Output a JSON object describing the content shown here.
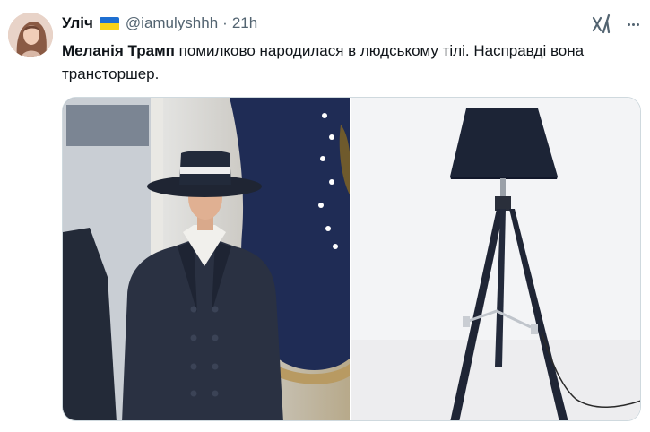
{
  "author": {
    "name": "Уліч",
    "flag": "ukraine-flag",
    "handle": "@iamulyshhh",
    "separator": "·",
    "time": "21h"
  },
  "tweet": {
    "bold_text": "Меланія Трамп",
    "text": " помилково народилася в людському тілі. Насправді вона трансторшер."
  },
  "media": {
    "images": [
      {
        "icon": "woman-in-hat-photo"
      },
      {
        "icon": "tripod-floor-lamp-photo"
      }
    ]
  },
  "icons": {
    "grok": "grok-icon",
    "more": "more-icon"
  },
  "colors": {
    "secondary_text": "#536471",
    "border": "#cfd9de",
    "flag_blue": "#1e6fd1",
    "flag_yellow": "#f7d31a"
  }
}
